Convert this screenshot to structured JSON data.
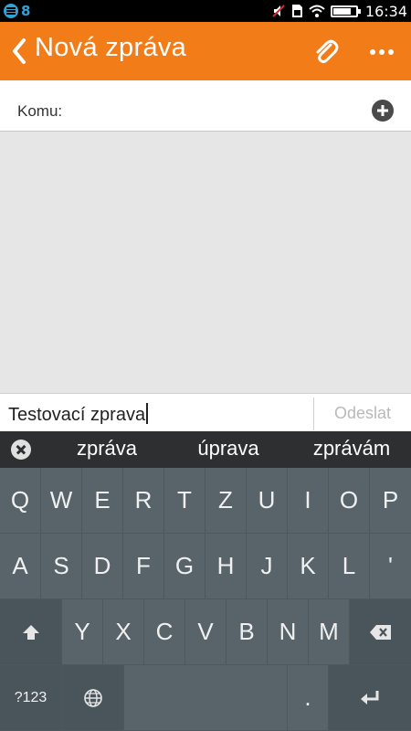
{
  "status_bar": {
    "notification_count": "8",
    "time": "16:34",
    "icons": [
      "muted-icon",
      "sim-icon",
      "wifi-icon",
      "battery-icon"
    ],
    "battery_level": 0.8
  },
  "header": {
    "title": "Nová zpráva",
    "color": "#f27d18",
    "icons": [
      "back-icon",
      "paperclip-icon",
      "more-icon"
    ]
  },
  "recipient": {
    "label": "Komu:",
    "value": ""
  },
  "compose": {
    "text": "Testovací zprava",
    "send_label": "Odeslat"
  },
  "suggestions": [
    "zpráva",
    "úprava",
    "zprávám"
  ],
  "keyboard": {
    "row1": [
      "Q",
      "W",
      "E",
      "R",
      "T",
      "Z",
      "U",
      "I",
      "O",
      "P"
    ],
    "row2": [
      "A",
      "S",
      "D",
      "F",
      "G",
      "H",
      "J",
      "K",
      "L",
      "'"
    ],
    "row3": [
      "Y",
      "X",
      "C",
      "V",
      "B",
      "N",
      "M"
    ],
    "symbols_label": "?123",
    "period_label": ".",
    "special_icons": [
      "shift-icon",
      "backspace-icon",
      "globe-icon",
      "enter-icon"
    ]
  }
}
